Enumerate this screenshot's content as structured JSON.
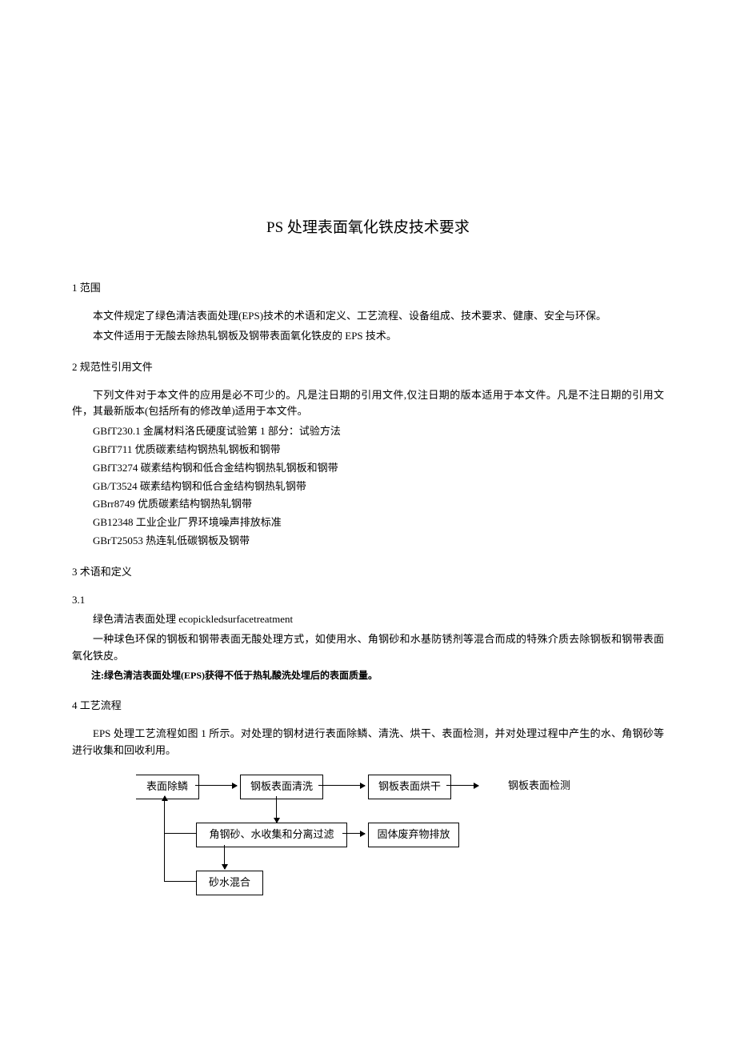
{
  "title": "PS 处理表面氧化铁皮技术要求",
  "sections": {
    "s1": {
      "heading": "1 范围",
      "p1": "本文件规定了绿色清洁表面处理(EPS)技术的术语和定义、工艺流程、设备组成、技术要求、健康、安全与环保。",
      "p2": "本文件适用于无酸去除热轧钢板及钢带表面氧化铁皮的 EPS 技术。"
    },
    "s2": {
      "heading": "2 规范性引用文件",
      "p1": "下列文件对于本文件的应用是必不可少的。凡是注日期的引用文件,仅注日期的版本适用于本文件。凡是不注日期的引用文件，其最新版本(包括所有的修改单)适用于本文件。",
      "refs": [
        "GBfT230.1 金属材料洛氏硬度试验第 1 部分：试验方法",
        "GBfT711 优质碳素结构钢热轧钢板和钢带",
        "GBfT3274 碳素结构钢和低合金结构钢热轧钢板和钢带",
        "GB/T3524 碳素结构钢和低合金结构钢热轧钢带",
        "GBrr8749 优质碳素结构钢热轧钢带",
        "GB12348 工业企业厂界环境噪声排放标准",
        "GBrT25053 热连轧低碳钢板及钢带"
      ]
    },
    "s3": {
      "heading": "3 术语和定义",
      "sub": "3.1",
      "term": "绿色清洁表面处理 ecopickledsurfacetreatment",
      "def": "一种球色环保的钢板和钢带表面无酸处理方式，如使用水、角钢砂和水基防锈剂等混合而成的特殊介质去除钢板和钢带表面氧化铁皮。",
      "note": "注:绿色清洁表面处埋(EPS)获得不低于热轧酸洗处埋后的表面质量。"
    },
    "s4": {
      "heading": "4 工艺流程",
      "p1": "EPS 处理工艺流程如图 1 所示。对处理的钢材进行表面除鳞、清洗、烘干、表面检测，并对处理过程中产生的水、角钢砂等进行收集和回收利用。"
    }
  },
  "flow": {
    "b1": "表面除鳞",
    "b2": "钢板表面清洗",
    "b3": "钢板表面烘干",
    "b4": "钢板表面检测",
    "b5": "角钢砂、水收集和分离过滤",
    "b6": "固体废弃物排放",
    "b7": "砂水混合"
  }
}
